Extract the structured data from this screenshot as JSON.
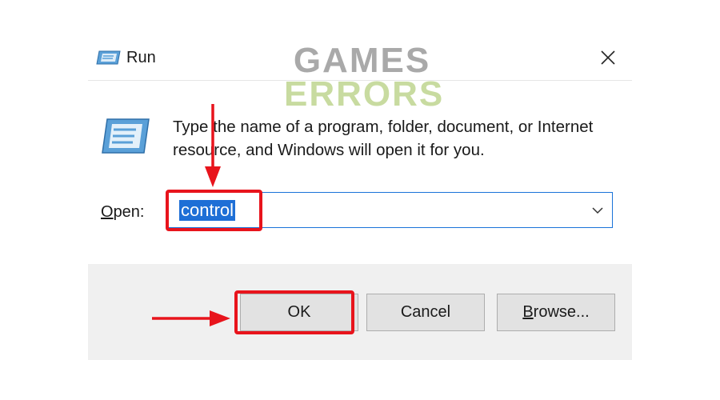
{
  "dialog": {
    "title": "Run",
    "close_glyph": "✕",
    "description": "Type the name of a program, folder, document, or Internet resource, and Windows will open it for you.",
    "open_label_accel": "O",
    "open_label_rest": "pen:",
    "open_value": "control",
    "buttons": {
      "ok": "OK",
      "cancel": "Cancel",
      "browse_accel": "B",
      "browse_rest": "rowse..."
    }
  },
  "watermark": {
    "line1": "GAMES",
    "line2": "ERRORS"
  },
  "colors": {
    "highlight": "#e8141c",
    "selection": "#1e6fd6",
    "footer_bg": "#f0f0f0",
    "watermark_gray": "#a9a9a9",
    "watermark_green": "#c8dba0"
  },
  "icons": [
    "run-icon",
    "close-icon",
    "chevron-down-icon",
    "arrow-down-icon",
    "arrow-right-icon"
  ]
}
